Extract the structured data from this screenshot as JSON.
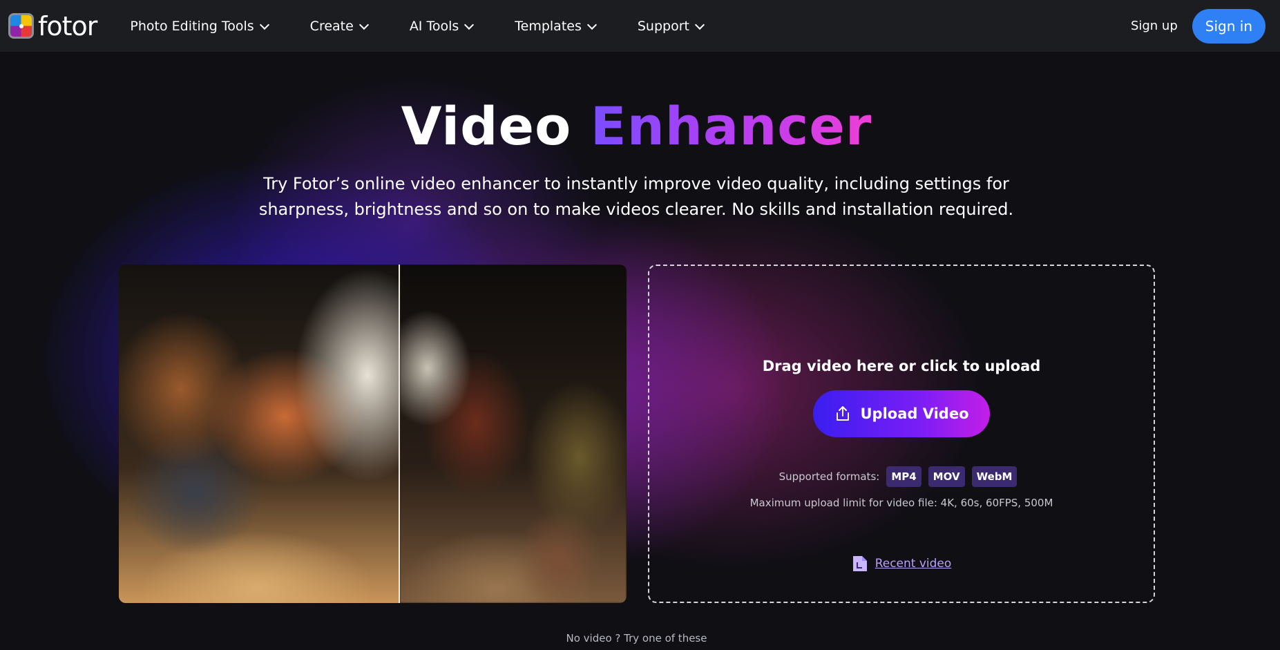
{
  "brand": {
    "name": "fotor"
  },
  "nav": {
    "items": [
      {
        "label": "Photo Editing Tools"
      },
      {
        "label": "Create"
      },
      {
        "label": "AI Tools"
      },
      {
        "label": "Templates"
      },
      {
        "label": "Support"
      }
    ],
    "signup_label": "Sign up",
    "signin_label": "Sign in"
  },
  "hero": {
    "title_plain": "Video",
    "title_accent": "Enhancer",
    "subtitle": "Try Fotor’s online video enhancer to instantly improve video quality, including settings for sharpness, brightness and so on to make videos clearer. No skills and installation required."
  },
  "upload": {
    "drag_text": "Drag video here or click to upload",
    "button_label": "Upload Video",
    "formats_label": "Supported formats:",
    "formats": [
      "MP4",
      "MOV",
      "WebM"
    ],
    "limit_text": "Maximum upload limit for video file: 4K, 60s, 60FPS, 500M",
    "recent_label": "Recent video"
  },
  "footer_hint": "No video ? Try one of these",
  "colors": {
    "nav_bg": "#1c1d21",
    "signin_bg": "#2f80f5",
    "accent_start": "#7a4cff",
    "accent_end": "#ef3fd6",
    "upload_btn_start": "#3a1ef0",
    "upload_btn_end": "#c41ee8",
    "format_chip_bg": "#3b2a70",
    "link": "#b8a0ff"
  }
}
